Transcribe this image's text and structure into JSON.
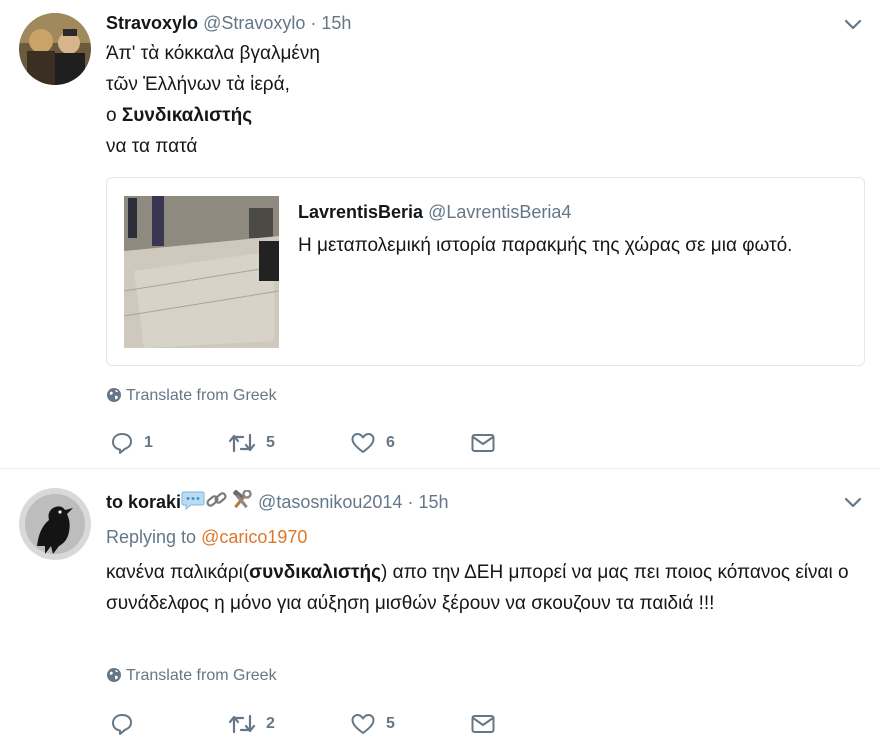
{
  "tweets": [
    {
      "name": "Stravoxylo",
      "handle": "@Stravoxylo",
      "sep": "·",
      "time": "15h",
      "lines": [
        "Άπ' τὰ κόκκαλα βγαλμένη",
        "τῶν Ἑλλήνων τὰ ἱερά,"
      ],
      "line3_prefix": "ο ",
      "line3_bold": "Συνδικαλιστής",
      "line4": "να τα πατά",
      "quote": {
        "name": "LavrentisBeria",
        "handle": "@LavrentisBeria4",
        "text": "Η μεταπολεμική ιστορία παρακμής της χώρας σε μια φωτό."
      },
      "translate": "Translate from Greek",
      "actions": {
        "reply": "1",
        "retweet": "5",
        "like": "6"
      }
    },
    {
      "name": "to koraki",
      "handle": "@tasosnikou2014",
      "sep": "·",
      "time": "15h",
      "replying_prefix": "Replying to ",
      "replying_to": "@carico1970",
      "text_pre": "κανένα παλικάρι(",
      "text_bold": "συνδικαλιστής",
      "text_post": ") απο την ΔΕΗ μπορεί να μας πει ποιος κόπανος είναι ο συνάδελφος η μόνο για αύξηση μισθών ξέρουν να σκουζουν τα παιδιά !!!",
      "translate": "Translate from Greek",
      "actions": {
        "reply": "",
        "retweet": "2",
        "like": "5"
      }
    }
  ],
  "colors": {
    "accent_link": "#e0762c",
    "muted": "#657786",
    "text": "#14171a"
  },
  "icons": [
    "chevron-down-icon",
    "globe-icon",
    "reply-icon",
    "retweet-icon",
    "heart-icon",
    "mail-icon",
    "speech-bubble-emoji",
    "link-emoji",
    "hammer-wrench-emoji"
  ]
}
